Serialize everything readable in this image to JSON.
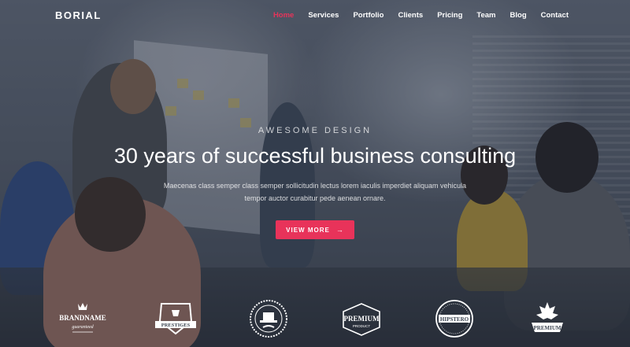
{
  "brand": "BORIAL",
  "nav": {
    "items": [
      {
        "label": "Home",
        "active": true
      },
      {
        "label": "Services",
        "active": false
      },
      {
        "label": "Portfolio",
        "active": false
      },
      {
        "label": "Clients",
        "active": false
      },
      {
        "label": "Pricing",
        "active": false
      },
      {
        "label": "Team",
        "active": false
      },
      {
        "label": "Blog",
        "active": false
      },
      {
        "label": "Contact",
        "active": false
      }
    ]
  },
  "hero": {
    "eyebrow": "AWESOME DESIGN",
    "headline": "30 years of successful business consulting",
    "subtext": "Maecenas class semper class semper sollicitudin lectus lorem iaculis imperdiet aliquam vehicula tempor auctor curabitur pede aenean ornare.",
    "cta_label": "VIEW MORE",
    "cta_icon": "arrow-right-icon"
  },
  "logos": [
    {
      "name": "brandname-logo",
      "text": "BRANDNAME",
      "tagline": "guaranteed"
    },
    {
      "name": "prestiges-logo",
      "text": "PRESTIGES"
    },
    {
      "name": "hat-badge-logo",
      "text": ""
    },
    {
      "name": "premium-product-logo",
      "text": "PREMIUM",
      "tagline": "PRODUCT"
    },
    {
      "name": "hipstero-logo",
      "text": "HIPSTERO"
    },
    {
      "name": "premium-leaf-logo",
      "text": "PREMIUM"
    }
  ],
  "colors": {
    "accent": "#e8335a",
    "text": "#ffffff"
  }
}
